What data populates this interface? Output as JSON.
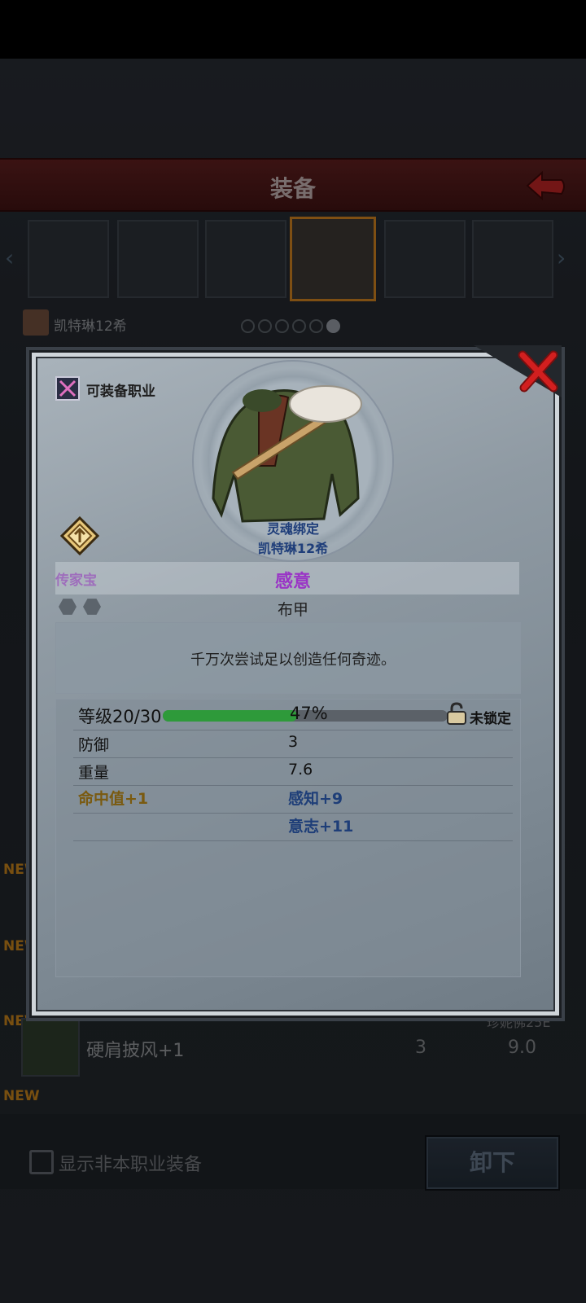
{
  "colors": {
    "header_red": "#5a1e1e",
    "popup_bg": "#8f9aa3",
    "accent_orange": "#c27a1e",
    "item_name_purple": "#9a34c6",
    "bonus_blue": "#1e3e78",
    "bonus_gold": "#7a5a10",
    "level_bar_green": "#2e9a3a",
    "close_red": "#d21f1f"
  },
  "background": {
    "header_title": "装备",
    "owner": "凯特琳12希",
    "list_new_tags": [
      "NEW",
      "NEW",
      "NEW",
      "NEW"
    ],
    "list_item": {
      "name": "硬肩披风+1",
      "value1": "3",
      "value2": "9.0",
      "owner": "珍妮佛25E"
    },
    "show_all_label": "显示非本职业装备",
    "unequip_label": "卸下"
  },
  "popup": {
    "class_label": "可装备职业",
    "soul_bound": "灵魂绑定",
    "bound_owner": "凯特琳12希",
    "rarity": "传家宝",
    "item_name": "感意",
    "item_type": "布甲",
    "description": "千万次尝试足以创造任何奇迹。",
    "level": {
      "label": "等级20/30",
      "percent_text": "47%",
      "progress": 0.47,
      "lock_label": "未锁定"
    },
    "stats": [
      {
        "label": "防御",
        "value": "3"
      },
      {
        "label": "重量",
        "value": "7.6"
      }
    ],
    "bonuses_left": [
      "命中值+1"
    ],
    "bonuses_right": [
      "感知+9",
      "意志+11"
    ]
  }
}
